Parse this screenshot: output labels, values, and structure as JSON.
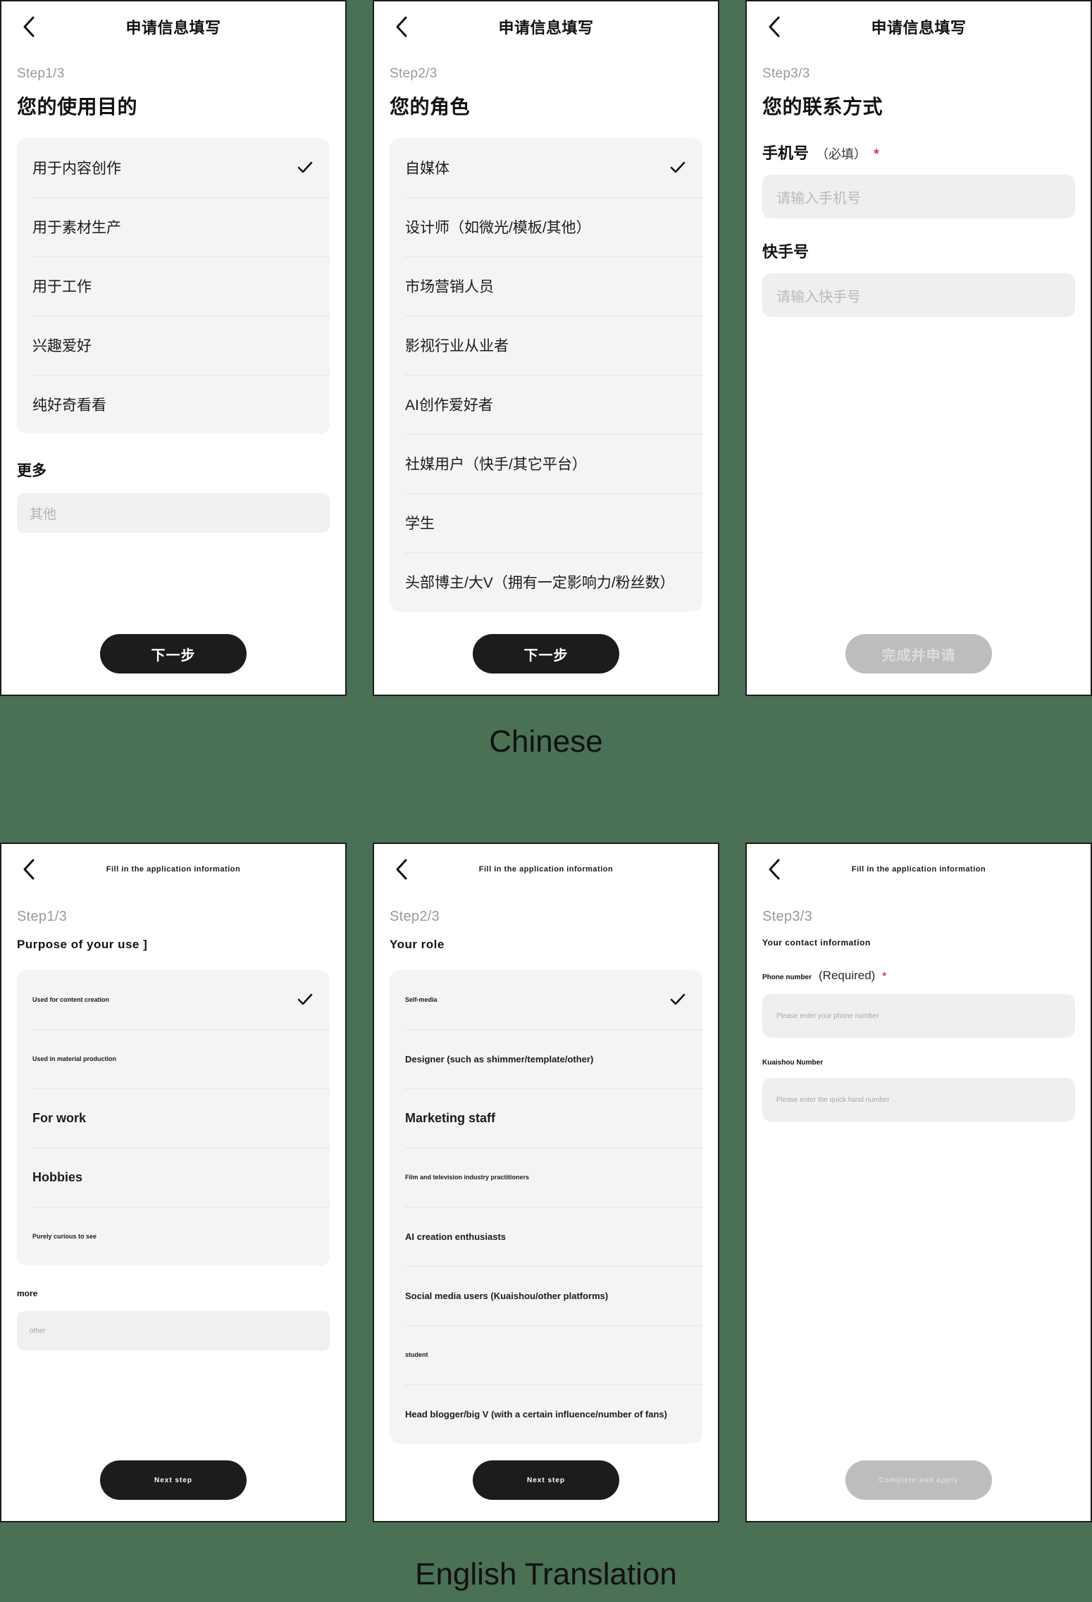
{
  "colors": {
    "background": "#4a7055",
    "panel": "#ffffff",
    "card": "#f4f4f4",
    "input": "#f0f0f0",
    "button": "#1c1c1c",
    "button_disabled": "#bdbdbd",
    "required_star": "#e0395c",
    "muted_text": "#9a9a9a"
  },
  "captions": {
    "chinese": "Chinese",
    "english": "English Translation"
  },
  "chinese": {
    "nav_title": "申请信息填写",
    "back_icon": "chevron-left-icon",
    "step1": {
      "step": "Step1/3",
      "title": "您的使用目的",
      "options": [
        {
          "label": "用于内容创作",
          "selected": true
        },
        {
          "label": "用于素材生产",
          "selected": false
        },
        {
          "label": "用于工作",
          "selected": false
        },
        {
          "label": "兴趣爱好",
          "selected": false
        },
        {
          "label": "纯好奇看看",
          "selected": false
        }
      ],
      "more_label": "更多",
      "other_placeholder": "其他",
      "other_value": "",
      "button": "下一步",
      "button_disabled": false
    },
    "step2": {
      "step": "Step2/3",
      "title": "您的角色",
      "options": [
        {
          "label": "自媒体",
          "selected": true
        },
        {
          "label": "设计师（如微光/模板/其他）",
          "selected": false
        },
        {
          "label": "市场营销人员",
          "selected": false
        },
        {
          "label": "影视行业从业者",
          "selected": false
        },
        {
          "label": "AI创作爱好者",
          "selected": false
        },
        {
          "label": "社媒用户（快手/其它平台）",
          "selected": false
        },
        {
          "label": "学生",
          "selected": false
        },
        {
          "label": "头部博主/大V（拥有一定影响力/粉丝数）",
          "selected": false
        }
      ],
      "button": "下一步",
      "button_disabled": false
    },
    "step3": {
      "step": "Step3/3",
      "title": "您的联系方式",
      "phone_label": "手机号",
      "phone_optional": "（必填）",
      "phone_star": "*",
      "phone_placeholder": "请输入手机号",
      "phone_value": "",
      "kuaishou_label": "快手号",
      "kuaishou_placeholder": "请输入快手号",
      "kuaishou_value": "",
      "button": "完成并申请",
      "button_disabled": true
    }
  },
  "english": {
    "nav_title": "Fill in the application information",
    "back_icon": "chevron-left-icon",
    "step1": {
      "step": "Step1/3",
      "title": "Purpose of your use ]",
      "options": [
        {
          "label": "Used for content creation",
          "selected": true,
          "size": "sm"
        },
        {
          "label": "Used in material production",
          "selected": false,
          "size": "sm"
        },
        {
          "label": "For work",
          "selected": false,
          "size": "lg"
        },
        {
          "label": "Hobbies",
          "selected": false,
          "size": "lg"
        },
        {
          "label": "Purely curious to see",
          "selected": false,
          "size": "sm"
        }
      ],
      "more_label": "more",
      "other_placeholder": "other",
      "other_value": "",
      "button": "Next step",
      "button_disabled": false
    },
    "step2": {
      "step": "Step2/3",
      "title": "Your role",
      "options": [
        {
          "label": "Self-media",
          "selected": true,
          "size": "sm"
        },
        {
          "label": "Designer (such as shimmer/template/other)",
          "selected": false,
          "size": "md"
        },
        {
          "label": "Marketing staff",
          "selected": false,
          "size": "lg"
        },
        {
          "label": "Film and television industry practitioners",
          "selected": false,
          "size": "sm"
        },
        {
          "label": "AI creation enthusiasts",
          "selected": false,
          "size": "md"
        },
        {
          "label": "Social media users (Kuaishou/other platforms)",
          "selected": false,
          "size": "md"
        },
        {
          "label": "student",
          "selected": false,
          "size": "sm"
        },
        {
          "label": "Head blogger/big V (with a certain influence/number of fans)",
          "selected": false,
          "size": "md"
        }
      ],
      "button": "Next step",
      "button_disabled": false
    },
    "step3": {
      "step": "Step3/3",
      "title": "Your contact information",
      "phone_label": "Phone number",
      "phone_optional": "(Required)",
      "phone_star": "*",
      "phone_placeholder": "Please enter your phone number",
      "phone_value": "",
      "kuaishou_label": "Kuaishou Number",
      "kuaishou_placeholder": "Please enter the quick hand number",
      "kuaishou_value": "",
      "button": "Complete and apply",
      "button_disabled": true
    }
  }
}
